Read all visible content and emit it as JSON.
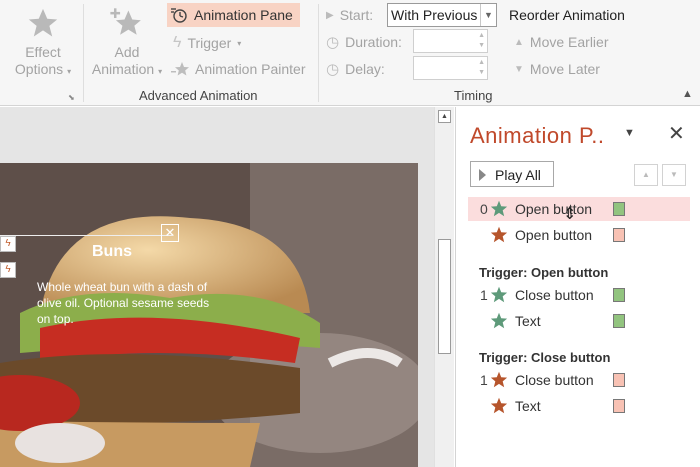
{
  "ribbon": {
    "effect_options": {
      "label_line1": "Effect",
      "label_line2": "Options"
    },
    "add_animation": {
      "label_line1": "Add",
      "label_line2": "Animation"
    },
    "animation_pane": "Animation Pane",
    "trigger": "Trigger",
    "animation_painter": "Animation Painter",
    "group_advanced": "Advanced Animation",
    "start_label": "Start:",
    "start_value": "With Previous",
    "duration_label": "Duration:",
    "delay_label": "Delay:",
    "reorder_title": "Reorder Animation",
    "move_earlier": "Move Earlier",
    "move_later": "Move Later",
    "group_timing": "Timing"
  },
  "slide": {
    "callout_title": "Buns",
    "callout_body": "Whole wheat bun with a dash of olive oil. Optional sesame seeds on top.",
    "close_glyph": "✕"
  },
  "pane": {
    "title": "Animation P..",
    "play_all": "Play All",
    "groups": [
      {
        "trigger": "",
        "items": [
          {
            "num": "0",
            "label": "Open button",
            "star_color": "#5e9a7a",
            "swatch": "green",
            "selected": true
          },
          {
            "num": "",
            "label": "Open button",
            "star_color": "#b6552c",
            "swatch": "pink",
            "selected": false
          }
        ]
      },
      {
        "trigger": "Trigger: Open button",
        "items": [
          {
            "num": "1",
            "label": "Close button",
            "star_color": "#5e9a7a",
            "swatch": "green",
            "selected": false
          },
          {
            "num": "",
            "label": "Text",
            "star_color": "#5e9a7a",
            "swatch": "green",
            "selected": false
          }
        ]
      },
      {
        "trigger": "Trigger: Close button",
        "items": [
          {
            "num": "1",
            "label": "Close button",
            "star_color": "#b6552c",
            "swatch": "pink",
            "selected": false
          },
          {
            "num": "",
            "label": "Text",
            "star_color": "#b6552c",
            "swatch": "pink",
            "selected": false
          }
        ]
      }
    ]
  },
  "colors": {
    "accent": "#c0492b",
    "selection": "#fbdddd",
    "highlight_button": "#f8d3c4"
  }
}
